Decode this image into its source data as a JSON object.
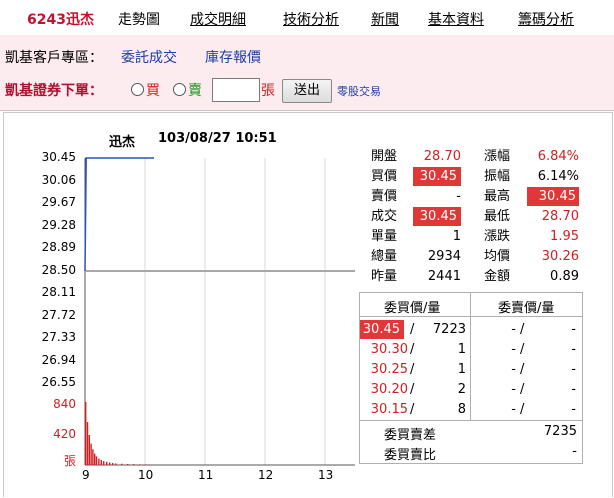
{
  "nav": {
    "stock_tab": "6243迅杰",
    "tabs": [
      "走勢圖",
      "成交明細",
      "技術分析",
      "新聞",
      "基本資料",
      "籌碼分析"
    ]
  },
  "customer_area": {
    "label": "凱基客戶專區：",
    "link1": "委託成交",
    "link2": "庫存報價"
  },
  "order": {
    "title": "凱基證券下單：",
    "buy_label": "買",
    "sell_label": "賣",
    "qty_value": "",
    "unit_label": "張",
    "send_button": "送出",
    "odd_lot_link": "零股交易"
  },
  "chart": {
    "stock_name": "迅杰",
    "datetime": "103/08/27 10:51",
    "volume_unit": "張",
    "y_ticks": [
      "30.45",
      "30.06",
      "29.67",
      "29.28",
      "28.89",
      "28.50",
      "28.11",
      "27.72",
      "27.33",
      "26.94",
      "26.55"
    ],
    "vol_ticks": [
      "840",
      "420"
    ],
    "x_ticks": [
      "9",
      "10",
      "11",
      "12",
      "13"
    ]
  },
  "chart_data": {
    "type": "line",
    "title": "迅杰 103/08/27 10:51",
    "reference_price": 28.5,
    "ylim": [
      26.55,
      30.45
    ],
    "x_range": [
      9,
      13.5
    ],
    "price_series": {
      "x": [
        9.0,
        9.02,
        9.05,
        10.15
      ],
      "y": [
        28.5,
        30.45,
        30.45,
        30.45
      ]
    },
    "volume_series": {
      "ylim": [
        0,
        840
      ],
      "x": [
        9.0,
        9.03,
        9.06,
        9.09,
        9.12,
        9.15,
        9.18,
        9.22,
        9.26,
        9.3,
        9.35,
        9.4,
        9.45,
        9.5,
        9.6,
        9.7,
        9.8,
        9.9,
        10.0,
        10.1
      ],
      "values": [
        880,
        600,
        420,
        300,
        220,
        160,
        120,
        90,
        70,
        55,
        45,
        35,
        28,
        22,
        18,
        14,
        12,
        10,
        8,
        6
      ]
    }
  },
  "quote": {
    "rows": [
      {
        "l1": "開盤",
        "v1": "28.70",
        "v1_class": "red",
        "l2": "漲幅",
        "v2": "6.84%",
        "v2_class": "red"
      },
      {
        "l1": "買價",
        "v1": "30.45",
        "v1_class": "hl",
        "l2": "振幅",
        "v2": "6.14%",
        "v2_class": ""
      },
      {
        "l1": "賣價",
        "v1": "-",
        "v1_class": "",
        "l2": "最高",
        "v2": "30.45",
        "v2_class": "hl"
      },
      {
        "l1": "成交",
        "v1": "30.45",
        "v1_class": "hl",
        "l2": "最低",
        "v2": "28.70",
        "v2_class": "red"
      },
      {
        "l1": "單量",
        "v1": "1",
        "v1_class": "",
        "l2": "漲跌",
        "v2": "1.95",
        "v2_class": "red"
      },
      {
        "l1": "總量",
        "v1": "2934",
        "v1_class": "",
        "l2": "均價",
        "v2": "30.26",
        "v2_class": "red"
      },
      {
        "l1": "昨量",
        "v1": "2441",
        "v1_class": "",
        "l2": "金額",
        "v2": "0.89",
        "v2_class": ""
      }
    ]
  },
  "book": {
    "bid_header": "委買價/量",
    "ask_header": "委賣價/量",
    "rows": [
      {
        "bid_price": "30.45",
        "bid_qty": "7223",
        "ask_price": "-",
        "ask_qty": "-"
      },
      {
        "bid_price": "30.30",
        "bid_qty": "1",
        "ask_price": "-",
        "ask_qty": "-"
      },
      {
        "bid_price": "30.25",
        "bid_qty": "1",
        "ask_price": "-",
        "ask_qty": "-"
      },
      {
        "bid_price": "30.20",
        "bid_qty": "2",
        "ask_price": "-",
        "ask_qty": "-"
      },
      {
        "bid_price": "30.15",
        "bid_qty": "8",
        "ask_price": "-",
        "ask_qty": "-"
      }
    ],
    "spread_label": "委買賣差",
    "spread_value": "7235",
    "ratio_label": "委買賣比",
    "ratio_value": "-"
  }
}
